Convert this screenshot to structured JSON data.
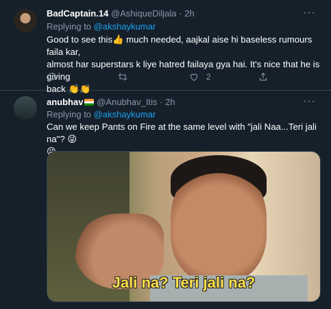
{
  "tweets": [
    {
      "name": "BadCaptain.14",
      "handle": "@AshiqueDiljala",
      "separator": "·",
      "time": "2h",
      "replying_prefix": "Replying to",
      "replying_to": "@akshaykumar",
      "text_line1": "Good to see this👍 much needed, aajkal aise hi baseless rumours faila kar,",
      "text_line2": "almost har superstars k liye hatred failaya gya hai. It's nice that he is giving",
      "text_line3": "back 👏👏",
      "like_count": "2"
    },
    {
      "name": "anubhav",
      "flag": "india-flag",
      "handle": "@Anubhav_Itis",
      "separator": "·",
      "time": "2h",
      "replying_prefix": "Replying to",
      "replying_to": "@akshaykumar",
      "text_line1": "Can we keep Pants on Fire at the same level with \"jali Naa...Teri jali na\"? 😜",
      "text_line2": "😜",
      "media_caption": "Jali na? Teri jali na?"
    }
  ],
  "icons": {
    "more": "more-icon",
    "reply": "reply-icon",
    "retweet": "retweet-icon",
    "like": "like-icon",
    "share": "share-icon"
  },
  "colors": {
    "background": "#15202b",
    "link": "#1da1f2",
    "muted": "#8899a6",
    "divider": "#38444d",
    "caption": "#ffe04d"
  }
}
